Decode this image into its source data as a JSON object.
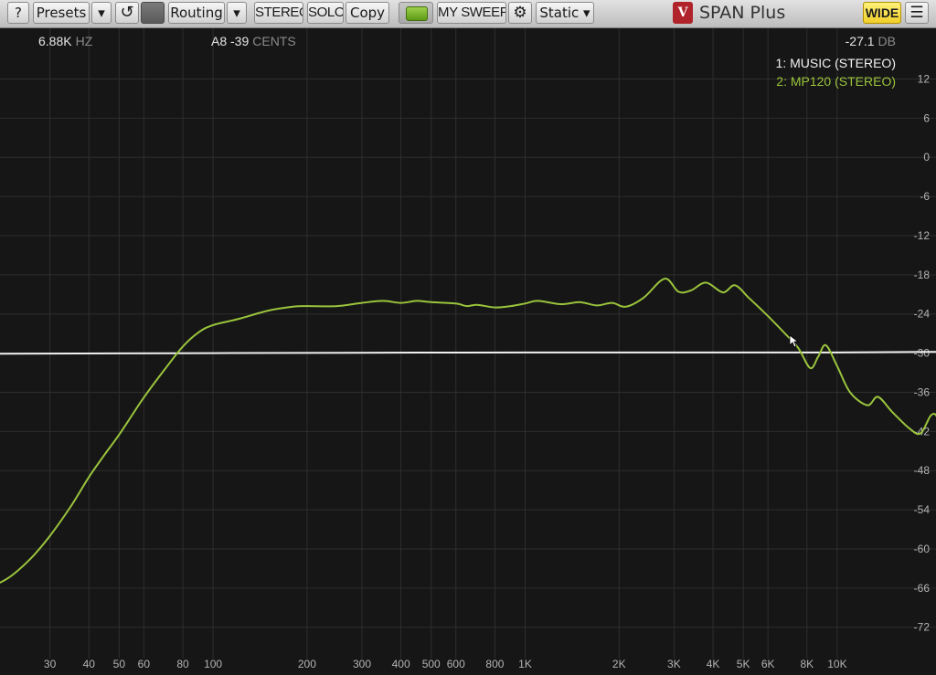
{
  "toolbar": {
    "help": "?",
    "presets": "Presets",
    "presets_menu": "▾",
    "undo": "↺",
    "routing": "Routing",
    "routing_menu": "▾",
    "stereo": "STEREO",
    "solo": "SOLO",
    "copy": "Copy",
    "preset_name": "MY SWEEP",
    "settings_icon": "⚙",
    "mode": "Static ▾",
    "brand": "SPAN Plus",
    "logo_glyph": "V",
    "wide": "WIDE",
    "menu_icon": "☰"
  },
  "readouts": {
    "frequency_value": "6.88K",
    "frequency_unit": "HZ",
    "note_value": "A8 -39",
    "note_unit": "CENTS",
    "level_value": "-27.1",
    "level_unit": "DB"
  },
  "legend": [
    {
      "label": "1: MUSIC (STEREO)",
      "color": "#f2f2f2"
    },
    {
      "label": "2: MP120 (STEREO)",
      "color": "#9ac43c"
    }
  ],
  "chart_data": {
    "type": "line",
    "xscale": "log",
    "xlim": [
      20,
      20000
    ],
    "ylim": [
      -78,
      18
    ],
    "grid": true,
    "x_ticks": [
      {
        "v": 30,
        "label": "30"
      },
      {
        "v": 40,
        "label": "40"
      },
      {
        "v": 50,
        "label": "50"
      },
      {
        "v": 60,
        "label": "60"
      },
      {
        "v": 80,
        "label": "80"
      },
      {
        "v": 100,
        "label": "100"
      },
      {
        "v": 200,
        "label": "200"
      },
      {
        "v": 300,
        "label": "300"
      },
      {
        "v": 400,
        "label": "400"
      },
      {
        "v": 500,
        "label": "500"
      },
      {
        "v": 600,
        "label": "600"
      },
      {
        "v": 800,
        "label": "800"
      },
      {
        "v": 1000,
        "label": "1K"
      },
      {
        "v": 2000,
        "label": "2K"
      },
      {
        "v": 3000,
        "label": "3K"
      },
      {
        "v": 4000,
        "label": "4K"
      },
      {
        "v": 5000,
        "label": "5K"
      },
      {
        "v": 6000,
        "label": "6K"
      },
      {
        "v": 8000,
        "label": "8K"
      },
      {
        "v": 10000,
        "label": "10K"
      }
    ],
    "y_ticks": [
      12,
      6,
      0,
      -6,
      -12,
      -18,
      -24,
      -30,
      -36,
      -42,
      -48,
      -54,
      -60,
      -66,
      -72
    ],
    "grid_color": "#2e2e2e",
    "series": [
      {
        "name": "1: MUSIC (STEREO)",
        "color": "#f0f0f0",
        "points": [
          [
            18,
            -30.1
          ],
          [
            100,
            -30.0
          ],
          [
            1000,
            -29.9
          ],
          [
            10000,
            -29.9
          ],
          [
            22000,
            -29.8
          ]
        ]
      },
      {
        "name": "2: MP120 (STEREO)",
        "color": "#9ac43c",
        "points": [
          [
            18,
            -66.5
          ],
          [
            22,
            -64.5
          ],
          [
            26,
            -61.5
          ],
          [
            30,
            -58.0
          ],
          [
            35,
            -53.5
          ],
          [
            40,
            -49.0
          ],
          [
            45,
            -45.5
          ],
          [
            50,
            -42.5
          ],
          [
            55,
            -39.5
          ],
          [
            60,
            -36.8
          ],
          [
            70,
            -32.5
          ],
          [
            80,
            -29.0
          ],
          [
            90,
            -26.8
          ],
          [
            100,
            -25.7
          ],
          [
            120,
            -24.8
          ],
          [
            150,
            -23.5
          ],
          [
            180,
            -22.9
          ],
          [
            200,
            -22.8
          ],
          [
            250,
            -22.8
          ],
          [
            300,
            -22.3
          ],
          [
            350,
            -22.0
          ],
          [
            400,
            -22.3
          ],
          [
            450,
            -22.0
          ],
          [
            500,
            -22.2
          ],
          [
            600,
            -22.4
          ],
          [
            650,
            -22.8
          ],
          [
            700,
            -22.6
          ],
          [
            800,
            -23.0
          ],
          [
            900,
            -22.8
          ],
          [
            1000,
            -22.4
          ],
          [
            1100,
            -22.0
          ],
          [
            1300,
            -22.5
          ],
          [
            1500,
            -22.2
          ],
          [
            1700,
            -22.7
          ],
          [
            1900,
            -22.3
          ],
          [
            2100,
            -22.9
          ],
          [
            2400,
            -21.5
          ],
          [
            2800,
            -18.6
          ],
          [
            3100,
            -20.6
          ],
          [
            3400,
            -20.4
          ],
          [
            3800,
            -19.2
          ],
          [
            4300,
            -20.7
          ],
          [
            4700,
            -19.6
          ],
          [
            5200,
            -21.5
          ],
          [
            5700,
            -23.3
          ],
          [
            6200,
            -25.0
          ],
          [
            6800,
            -27.0
          ],
          [
            7500,
            -29.2
          ],
          [
            8200,
            -32.3
          ],
          [
            8700,
            -30.5
          ],
          [
            9200,
            -28.8
          ],
          [
            10000,
            -32.0
          ],
          [
            11000,
            -36.0
          ],
          [
            12500,
            -38.0
          ],
          [
            13500,
            -36.7
          ],
          [
            15000,
            -39.0
          ],
          [
            17000,
            -41.5
          ],
          [
            18500,
            -42.3
          ],
          [
            20000,
            -39.5
          ],
          [
            21000,
            -40.0
          ],
          [
            22000,
            -44.0
          ],
          [
            23000,
            -48.5
          ]
        ]
      }
    ]
  }
}
